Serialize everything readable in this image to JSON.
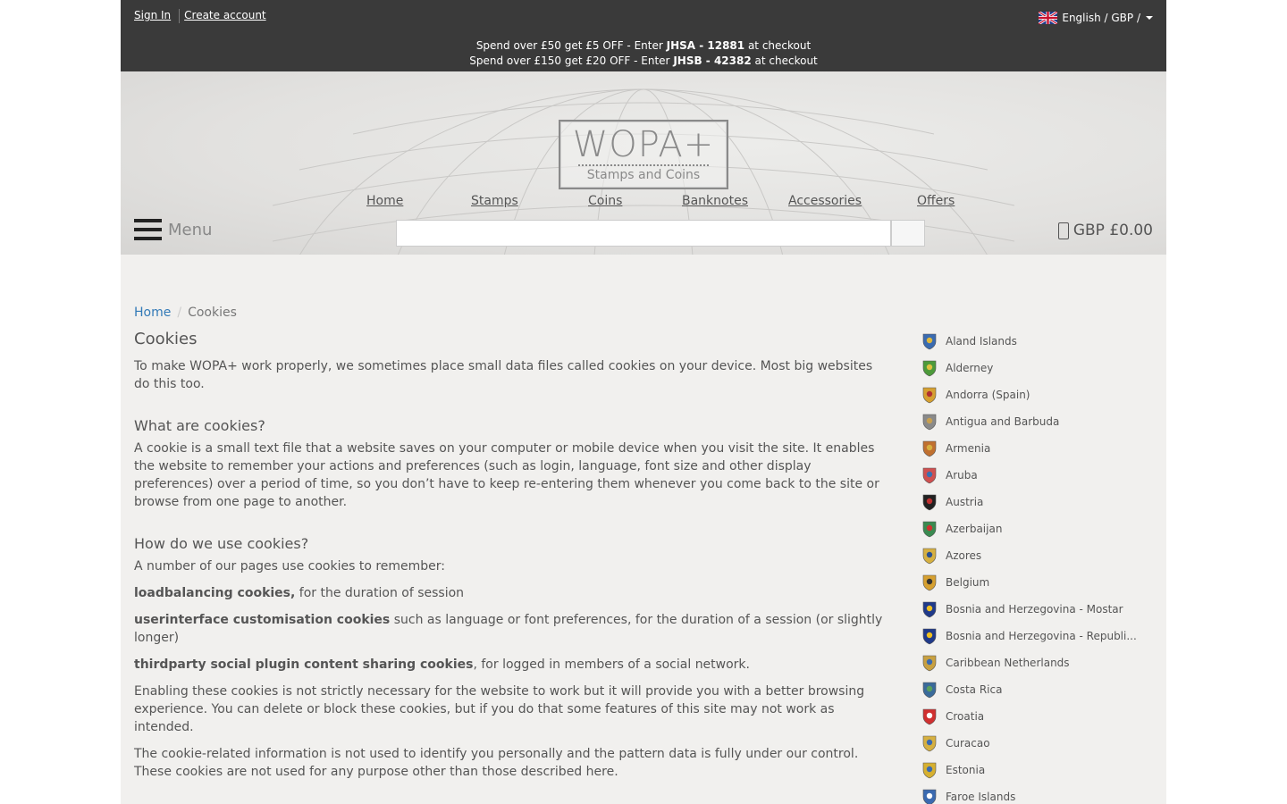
{
  "account": {
    "sign_in": "Sign In",
    "create_account": "Create account"
  },
  "locale": {
    "label": "English / GBP /"
  },
  "promos": [
    {
      "pre": "Spend over £50 get £5 OFF - Enter ",
      "code": "JHSA - 12881",
      "post": " at checkout"
    },
    {
      "pre": "Spend over £150 get £20 OFF - Enter ",
      "code": "JHSB - 42382",
      "post": " at checkout"
    }
  ],
  "logo": {
    "title": "WOPA+",
    "subtitle": "Stamps and Coins"
  },
  "nav": [
    "Home",
    "Stamps",
    "Coins",
    "Banknotes",
    "Accessories",
    "Offers"
  ],
  "menu": {
    "label": "Menu"
  },
  "search": {
    "placeholder": "",
    "button_glyph": ""
  },
  "cart": {
    "total": "GBP £0.00"
  },
  "breadcrumb": {
    "home": "Home",
    "current": "Cookies"
  },
  "article": {
    "title": "Cookies",
    "intro": "To make WOPA+ work properly, we sometimes place small data files called cookies on your device. Most big websites do this too.",
    "h_what": "What are cookies?",
    "what": "A cookie is a small text file that a website saves on your computer or mobile device when you visit the site. It enables the website to remember your actions and preferences (such as login, language, font size and other display preferences) over a period of time, so you don’t have to keep re-entering them whenever you come back to the site or browse from one page to another.",
    "h_how": "How do we use cookies?",
    "how_intro": "A number of our pages use cookies to remember:",
    "items": [
      {
        "b": "loadbalancing cookies,",
        "t": " for the duration of session"
      },
      {
        "b": "userinterface customisation cookies",
        "t": " such as language or font preferences, for the duration of a session (or slightly longer)"
      },
      {
        "b": "thirdparty social plugin content sharing cookies",
        "t": ", for logged in members of a social network."
      }
    ],
    "enabling": "Enabling these cookies is not strictly necessary for the website to work but it will provide you with a better browsing experience. You can delete or block these cookies, but if you do that some features of this site may not work as intended.",
    "info": "The cookie-related information is not used to identify you personally and the pattern data is fully under our control. These cookies are not used for any purpose other than those described here."
  },
  "countries": [
    {
      "name": "Aland Islands",
      "color": "#3a6bb0",
      "accent": "#e0b83a"
    },
    {
      "name": "Alderney",
      "color": "#4d9a3a",
      "accent": "#e0c040"
    },
    {
      "name": "Andorra (Spain)",
      "color": "#d6a030",
      "accent": "#b03030"
    },
    {
      "name": "Antigua and Barbuda",
      "color": "#8a8a8a",
      "accent": "#c8a050"
    },
    {
      "name": "Armenia",
      "color": "#c07030",
      "accent": "#d6b040"
    },
    {
      "name": "Aruba",
      "color": "#d05050",
      "accent": "#3a70b0"
    },
    {
      "name": "Austria",
      "color": "#222222",
      "accent": "#c03030"
    },
    {
      "name": "Azerbaijan",
      "color": "#3a8a50",
      "accent": "#d03030"
    },
    {
      "name": "Azores",
      "color": "#d6b040",
      "accent": "#2a5090"
    },
    {
      "name": "Belgium",
      "color": "#d6a030",
      "accent": "#333333"
    },
    {
      "name": "Bosnia and Herzegovina - Mostar",
      "color": "#203a8a",
      "accent": "#f0c020"
    },
    {
      "name": "Bosnia and Herzegovina - Republi...",
      "color": "#203a8a",
      "accent": "#f0c020"
    },
    {
      "name": "Caribbean Netherlands",
      "color": "#c8a040",
      "accent": "#3a6ab0"
    },
    {
      "name": "Costa Rica",
      "color": "#3a6a9a",
      "accent": "#5aa05a"
    },
    {
      "name": "Croatia",
      "color": "#d03030",
      "accent": "#ffffff"
    },
    {
      "name": "Curacao",
      "color": "#d6b040",
      "accent": "#3a6ab0"
    },
    {
      "name": "Estonia",
      "color": "#d6b030",
      "accent": "#3a6ab0"
    },
    {
      "name": "Faroe Islands",
      "color": "#3a6ab0",
      "accent": "#ffffff"
    }
  ]
}
